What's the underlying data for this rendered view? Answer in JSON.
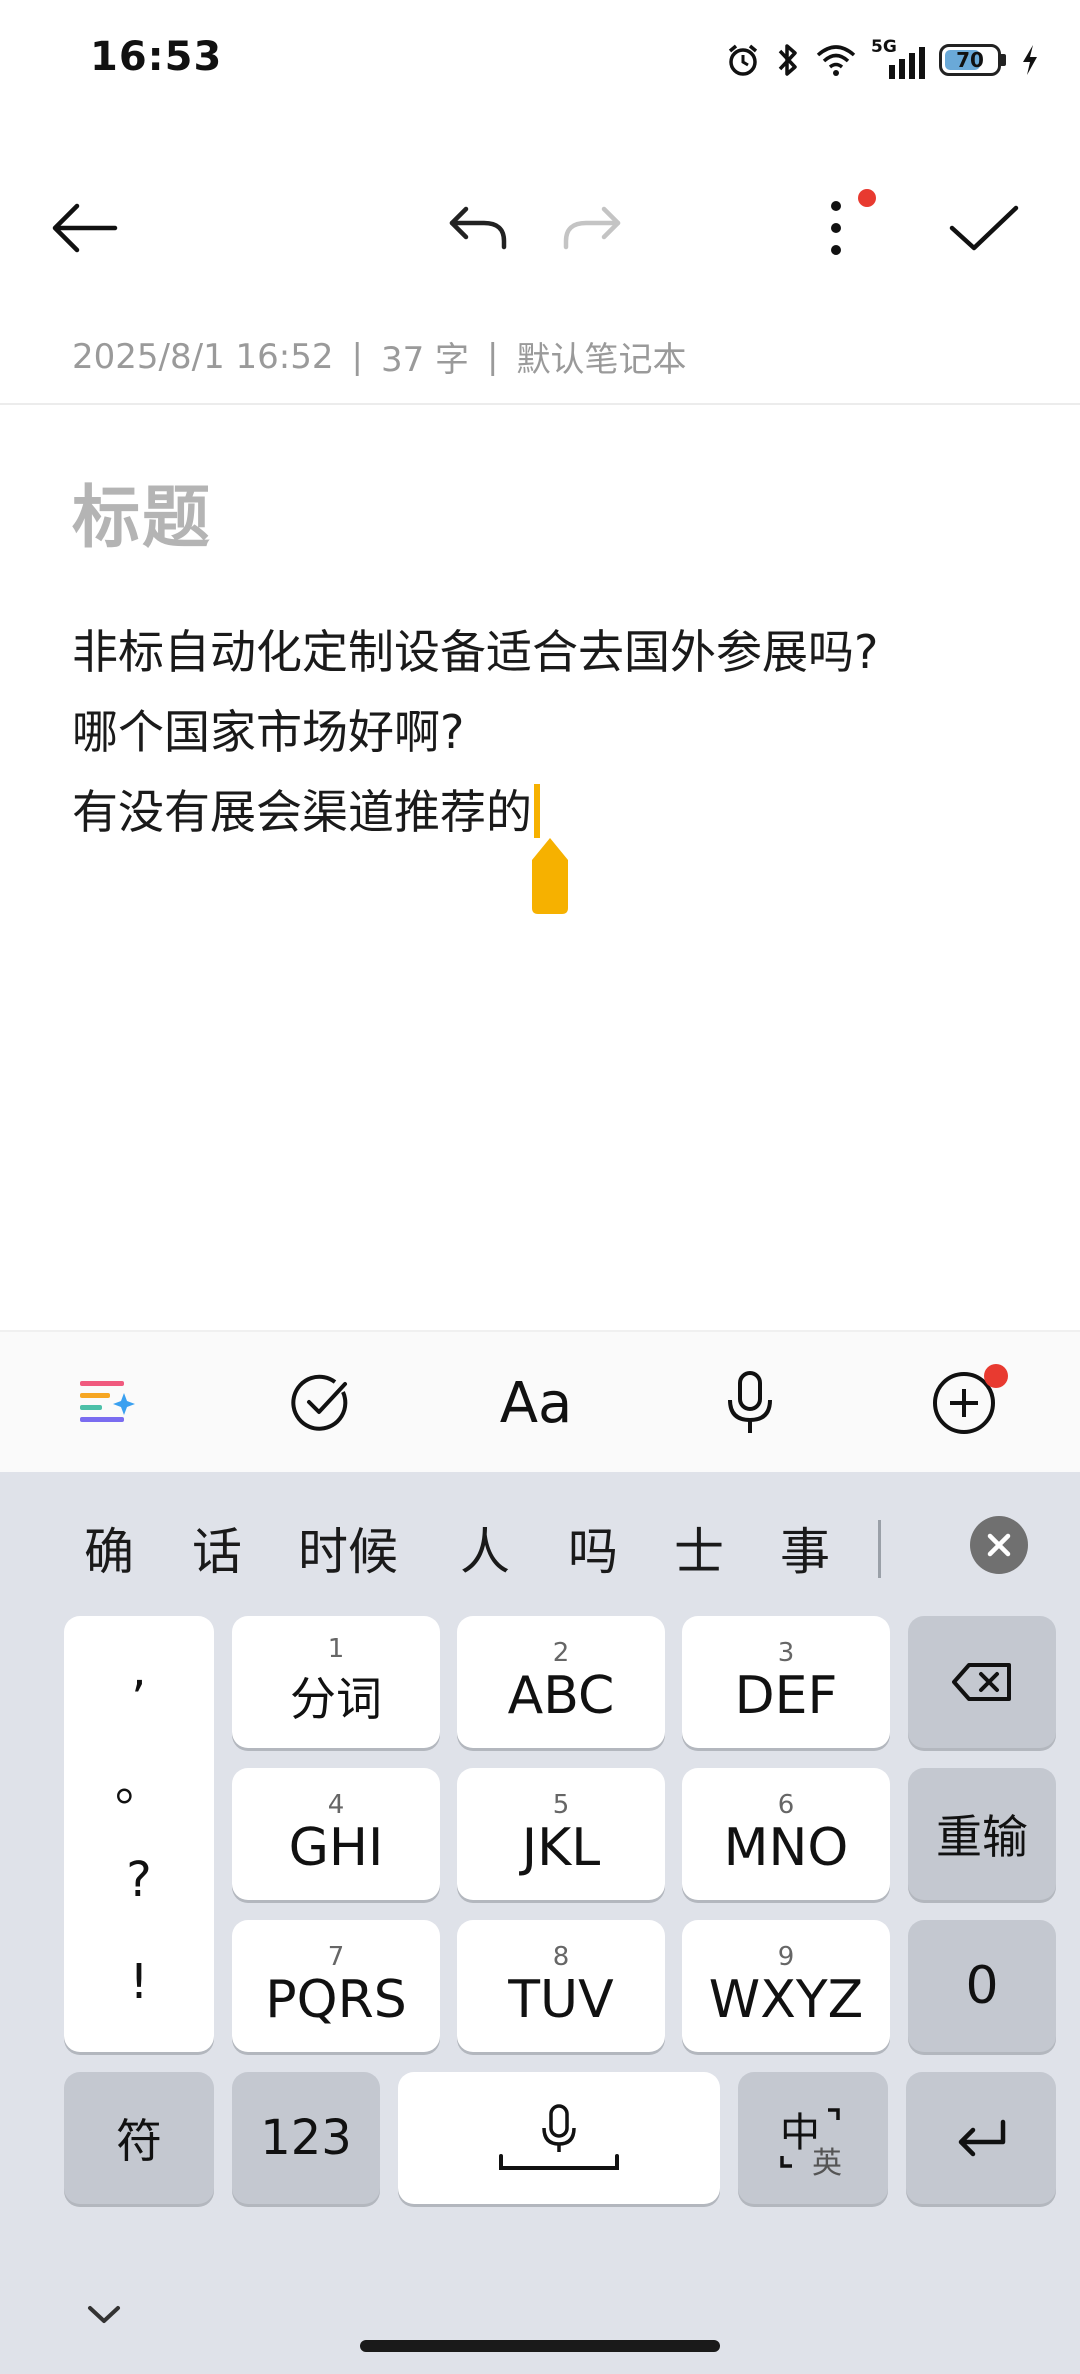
{
  "status_bar": {
    "time": "16:53",
    "network": "5G",
    "battery_level": "70",
    "battery_fraction": 0.7
  },
  "toolbar": {
    "back_icon": "arrow-left-icon",
    "undo_icon": "undo-icon",
    "redo_icon": "redo-icon",
    "more_icon": "more-vertical-icon",
    "done_icon": "checkmark-icon"
  },
  "meta": {
    "date": "2025/8/1 16:52",
    "word_count": "37 字",
    "notebook": "默认笔记本",
    "separator": "|"
  },
  "note": {
    "title_placeholder": "标题",
    "lines": [
      "非标自动化定制设备适合去国外参展吗?",
      "哪个国家市场好啊?",
      "有没有展会渠道推荐的"
    ]
  },
  "format_bar": {
    "ai_icon": "ai-sparkle-icon",
    "todo_icon": "check-circle-icon",
    "text_style_label": "Aa",
    "voice_icon": "microphone-icon",
    "add_icon": "plus-circle-icon"
  },
  "keyboard": {
    "candidates": [
      "确",
      "话",
      "时候",
      "人",
      "吗",
      "士",
      "事"
    ],
    "punctuation": [
      ",",
      "。",
      "?",
      "!"
    ],
    "keys": [
      {
        "num": "1",
        "label": "分词"
      },
      {
        "num": "2",
        "label": "ABC"
      },
      {
        "num": "3",
        "label": "DEF"
      },
      {
        "num": "4",
        "label": "GHI"
      },
      {
        "num": "5",
        "label": "JKL"
      },
      {
        "num": "6",
        "label": "MNO"
      },
      {
        "num": "7",
        "label": "PQRS"
      },
      {
        "num": "8",
        "label": "TUV"
      },
      {
        "num": "9",
        "label": "WXYZ"
      }
    ],
    "reinput_label": "重输",
    "zero_label": "0",
    "symbol_label": "符",
    "num_label": "123",
    "lang_main": "中",
    "lang_sub": "英"
  },
  "colors": {
    "accent_caret": "#f6b100",
    "badge_red": "#e83a30",
    "keyboard_bg": "#dfe2e9"
  }
}
